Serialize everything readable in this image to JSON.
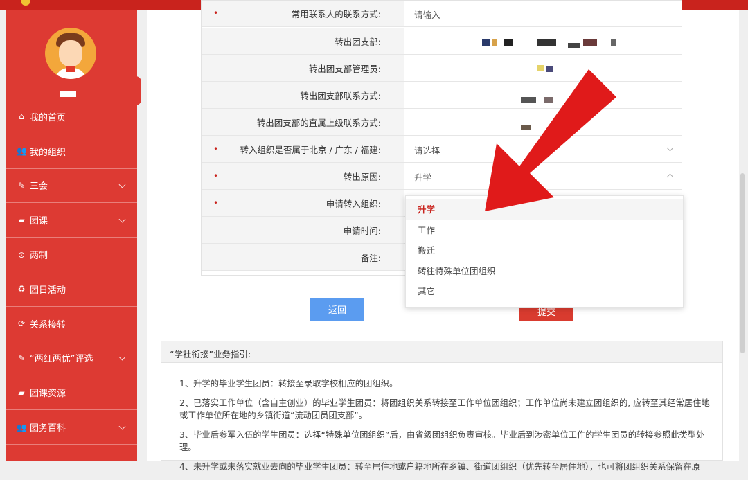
{
  "sidebar": {
    "menu": [
      {
        "icon": "home-icon",
        "glyph": "⌂",
        "label": "我的首页",
        "chevron": false
      },
      {
        "icon": "users-icon",
        "glyph": "👥",
        "label": "我的组织",
        "chevron": false
      },
      {
        "icon": "edit-icon",
        "glyph": "✎",
        "label": "三会",
        "chevron": true
      },
      {
        "icon": "folder-icon",
        "glyph": "▰",
        "label": "团课",
        "chevron": true
      },
      {
        "icon": "target-icon",
        "glyph": "⊙",
        "label": "两制",
        "chevron": false
      },
      {
        "icon": "recycle-icon",
        "glyph": "♻",
        "label": "团日活动",
        "chevron": false
      },
      {
        "icon": "refresh-icon",
        "glyph": "⟳",
        "label": "关系接转",
        "chevron": false
      },
      {
        "icon": "edit-icon",
        "glyph": "✎",
        "label": "“两红两优”评选",
        "chevron": true
      },
      {
        "icon": "folder-icon",
        "glyph": "▰",
        "label": "团课资源",
        "chevron": false
      },
      {
        "icon": "users-icon",
        "glyph": "👥",
        "label": "团务百科",
        "chevron": true
      }
    ]
  },
  "form": {
    "rows": [
      {
        "label": "常用联系人的联系方式:",
        "required": true,
        "value": "请输入",
        "control": "input"
      },
      {
        "label": "转出团支部:",
        "required": false,
        "value": "",
        "control": "text"
      },
      {
        "label": "转出团支部管理员:",
        "required": false,
        "value": "",
        "control": "text"
      },
      {
        "label": "转出团支部联系方式:",
        "required": false,
        "value": "",
        "control": "text"
      },
      {
        "label": "转出团支部的直属上级联系方式:",
        "required": false,
        "value": "",
        "control": "text"
      },
      {
        "label": "转入组织是否属于北京 / 广东 / 福建:",
        "required": true,
        "value": "请选择",
        "control": "select"
      },
      {
        "label": "转出原因:",
        "required": true,
        "value": "升学",
        "control": "select-open"
      },
      {
        "label": "申请转入组织:",
        "required": true,
        "value": "",
        "control": "text"
      },
      {
        "label": "申请时间:",
        "required": false,
        "value": "",
        "control": "text"
      },
      {
        "label": "备注:",
        "required": false,
        "value": "",
        "control": "text"
      }
    ]
  },
  "dropdown": {
    "options": [
      "升学",
      "工作",
      "搬迁",
      "转往特殊单位团组织",
      "其它"
    ],
    "selected": "升学"
  },
  "buttons": {
    "back": "返回",
    "submit": "提交"
  },
  "guide": {
    "title": "“学社衔接”业务指引:",
    "items": [
      "1、升学的毕业学生团员：转接至录取学校相应的团组织。",
      "2、已落实工作单位（含自主创业）的毕业学生团员：将团组织关系转接至工作单位团组织；工作单位尚未建立团组织的, 应转至其经常居住地或工作单位所在地的乡镇街道“流动团员团支部”。",
      "3、毕业后参军入伍的学生团员：选择“特殊单位团组织”后，由省级团组织负责审核。毕业后到涉密单位工作的学生团员的转接参照此类型处理。",
      "4、未升学或未落实就业去向的毕业学生团员：转至居住地或户籍地所在乡镇、街道团组织（优先转至居住地），也可将团组织关系保留在原"
    ]
  },
  "annotation": {
    "color": "#e01a1a"
  },
  "colors": {
    "brand": "#dd3a33",
    "primary": "#5b9cf0",
    "danger": "#d93b2f"
  }
}
